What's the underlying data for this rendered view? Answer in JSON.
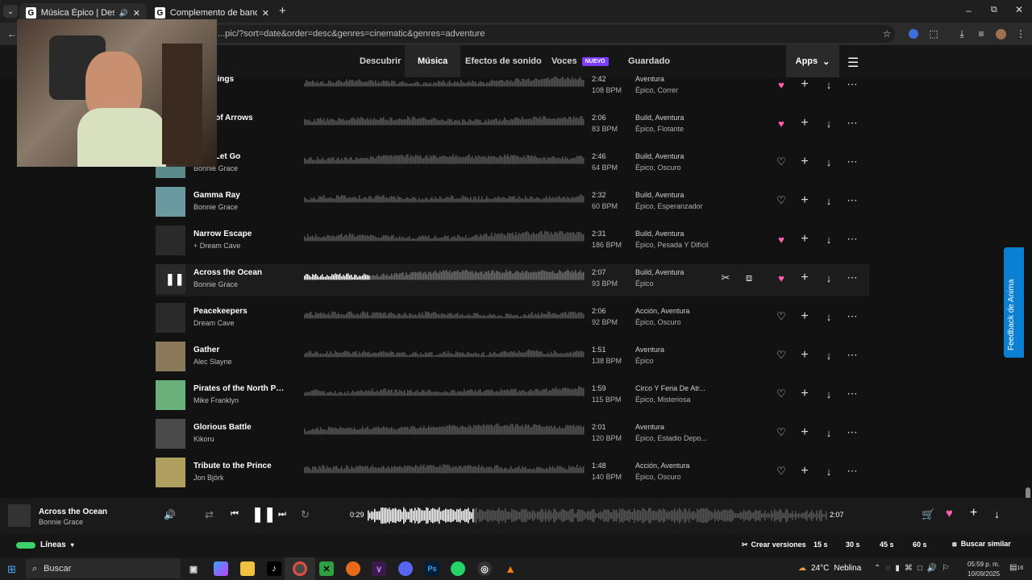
{
  "browser": {
    "tabs": [
      {
        "label": "Música Épico | Descarga sin",
        "favicon": "G"
      },
      {
        "label": "Complemento de bandas sono",
        "favicon": "G"
      }
    ],
    "url": "...pic/?sort=date&order=desc&genres=cinematic&genres=adventure"
  },
  "nav": {
    "items": [
      "Descubrir",
      "Música",
      "Efectos de sonido",
      "Voces",
      "Guardado"
    ],
    "badge": "NUEVO",
    "apps": "Apps"
  },
  "tracks": [
    {
      "title": "Bird Sings",
      "artist": "",
      "duration": "2:42",
      "bpm": "108 BPM",
      "genres": "Aventura",
      "moods": "Épico, Correr",
      "liked": true,
      "thumb": "#3a3a3a"
    },
    {
      "title": "ound of Arrows",
      "artist": "Grace",
      "duration": "2:06",
      "bpm": "83 BPM",
      "genres": "Build, Aventura",
      "moods": "Épico, Flotante",
      "liked": true,
      "thumb": "#3a3a3a"
    },
    {
      "title": "ne to Let Go",
      "artist": "Bonnie Grace",
      "duration": "2:46",
      "bpm": "64 BPM",
      "genres": "Build, Aventura",
      "moods": "Épico, Oscuro",
      "liked": false,
      "thumb": "#5a8a8a"
    },
    {
      "title": "Gamma Ray",
      "artist": "Bonnie Grace",
      "duration": "2:32",
      "bpm": "60 BPM",
      "genres": "Build, Aventura",
      "moods": "Épico, Esperanzador",
      "liked": false,
      "thumb": "#6a9aa0"
    },
    {
      "title": "Narrow Escape",
      "artist": "Dream Cave",
      "duration": "2:31",
      "bpm": "186 BPM",
      "genres": "Build, Aventura",
      "moods": "Épico, Pesada Y Difícil",
      "liked": true,
      "thumb": "#2a2a2a"
    },
    {
      "title": "Across the Ocean",
      "artist": "Bonnie Grace",
      "duration": "2:07",
      "bpm": "93 BPM",
      "genres": "Build, Aventura",
      "moods": "Épico",
      "liked": true,
      "thumb": "#2a2a2a"
    },
    {
      "title": "Peacekeepers",
      "artist": "Dream Cave",
      "duration": "2:06",
      "bpm": "92 BPM",
      "genres": "Acción, Aventura",
      "moods": "Épico, Oscuro",
      "liked": false,
      "thumb": "#2a2a2a"
    },
    {
      "title": "Gather",
      "artist": "Alec Slayne",
      "duration": "1:51",
      "bpm": "138 BPM",
      "genres": "Aventura",
      "moods": "Épico",
      "liked": false,
      "thumb": "#8a7a5a"
    },
    {
      "title": "Pirates of the North Pol...",
      "artist": "Mike Franklyn",
      "duration": "1:59",
      "bpm": "115 BPM",
      "genres": "Circo Y Feria De Atr...",
      "moods": "Épico, Misteriosa",
      "liked": false,
      "thumb": "#6ab07a"
    },
    {
      "title": "Glorious Battle",
      "artist": "Kikoru",
      "duration": "2:01",
      "bpm": "120 BPM",
      "genres": "Aventura",
      "moods": "Épico, Estadio Depo...",
      "liked": false,
      "thumb": "#4a4a4a"
    },
    {
      "title": "Tribute to the Prince",
      "artist": "Jon Björk",
      "duration": "1:48",
      "bpm": "140 BPM",
      "genres": "Acción, Aventura",
      "moods": "Épico, Oscuro",
      "liked": false,
      "thumb": "#b0a060"
    }
  ],
  "active_index": 5,
  "player": {
    "title": "Across the Ocean",
    "artist": "Bonnie Grace",
    "elapsed": "0:29",
    "total": "2:07",
    "progress": 0.23
  },
  "bottom": {
    "lines_label": "Líneas",
    "create_versions": "Crear versiones",
    "durations": [
      "15 s",
      "30 s",
      "45 s",
      "60 s"
    ],
    "search_similar": "Buscar similar"
  },
  "feedback": "Feedback de Anima",
  "taskbar": {
    "search": "Buscar",
    "weather": "24°C",
    "weather_desc": "Neblina",
    "time": "05:59 p. m.",
    "date": "10/09/2025",
    "notif": "16"
  },
  "colors": {
    "accent": "#7b3cff",
    "heart": "#ff5fb0",
    "feedback": "#0b7fd1"
  }
}
